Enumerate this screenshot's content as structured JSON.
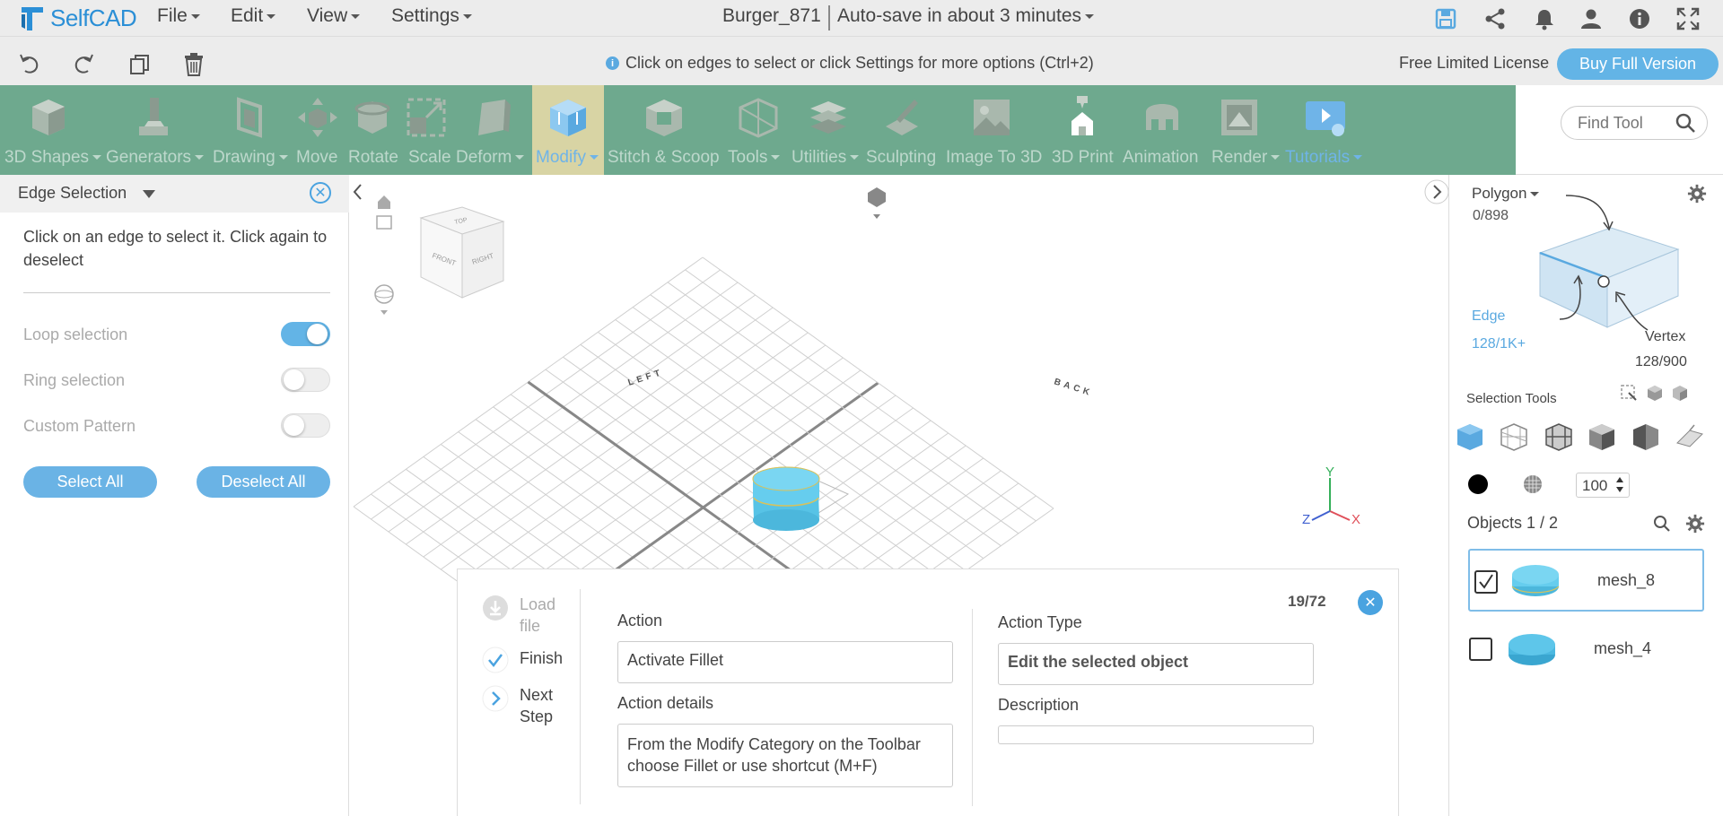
{
  "app": {
    "name": "SelfCAD"
  },
  "menu": {
    "file": "File",
    "edit": "Edit",
    "view": "View",
    "settings": "Settings"
  },
  "document": {
    "name": "Burger_871",
    "autosave": "Auto-save in about 3 minutes"
  },
  "top_icons": [
    "save-icon",
    "share-icon",
    "bell-icon",
    "user-icon",
    "info-icon",
    "fullscreen-icon"
  ],
  "secondary_bar": {
    "icons": [
      "undo-icon",
      "redo-icon",
      "copy-icon",
      "trash-icon"
    ],
    "hint": "Click on edges to select or click Settings for more options (Ctrl+2)",
    "license": "Free Limited License",
    "buy_button": "Buy Full Version"
  },
  "toolbar": {
    "tools": [
      {
        "label": "3D Shapes",
        "dropdown": true
      },
      {
        "label": "Generators",
        "dropdown": true
      },
      {
        "label": "Drawing",
        "dropdown": true
      },
      {
        "label": "Move",
        "dropdown": false
      },
      {
        "label": "Rotate",
        "dropdown": false
      },
      {
        "label": "Scale",
        "dropdown": false
      },
      {
        "label": "Deform",
        "dropdown": true
      },
      {
        "label": "Modify",
        "dropdown": true,
        "active": true
      },
      {
        "label": "Stitch & Scoop",
        "dropdown": false
      },
      {
        "label": "Tools",
        "dropdown": true
      },
      {
        "label": "Utilities",
        "dropdown": true
      },
      {
        "label": "Sculpting",
        "dropdown": false
      },
      {
        "label": "Image To 3D",
        "dropdown": false
      },
      {
        "label": "3D Print",
        "dropdown": false
      },
      {
        "label": "Animation",
        "dropdown": false
      },
      {
        "label": "Render",
        "dropdown": true
      },
      {
        "label": "Tutorials",
        "dropdown": true
      }
    ],
    "find_tool_placeholder": "Find Tool",
    "bg_color": "#6ea98e",
    "accent_color": "#63b4e6"
  },
  "left_panel": {
    "title": "Edge Selection",
    "description": "Click on an edge to select it. Click again to deselect",
    "options": [
      {
        "label": "Loop selection",
        "on": true
      },
      {
        "label": "Ring selection",
        "on": false
      },
      {
        "label": "Custom Pattern",
        "on": false
      }
    ],
    "select_all": "Select All",
    "deselect_all": "Deselect All"
  },
  "viewport": {
    "grid_labels": {
      "left": "LEFT",
      "back": "BACK"
    },
    "cube_faces": {
      "top": "TOP",
      "front": "FRONT",
      "right": "RIGHT"
    },
    "axes": {
      "x": "X",
      "y": "Y",
      "z": "Z"
    }
  },
  "wizard": {
    "step_counter": "19/72",
    "steps": {
      "load_file": "Load file",
      "finish": "Finish",
      "next_step": "Next Step"
    },
    "action_label": "Action",
    "action_value": "Activate Fillet",
    "action_details_label": "Action details",
    "action_details_value": "From the Modify Category on the Toolbar choose Fillet or use shortcut (M+F)",
    "action_type_label": "Action Type",
    "action_type_value": "Edit the selected object",
    "description_label": "Description",
    "description_value": ""
  },
  "right_panel": {
    "polygon_label": "Polygon",
    "polygon_count": "0/898",
    "edge_label": "Edge",
    "edge_count": "128/1K+",
    "vertex_label": "Vertex",
    "vertex_count": "128/900",
    "selection_tools_label": "Selection Tools",
    "opacity_value": "100",
    "objects_label": "Objects 1 / 2",
    "objects": [
      {
        "name": "mesh_8",
        "checked": true,
        "selected": true
      },
      {
        "name": "mesh_4",
        "checked": false,
        "selected": false
      }
    ]
  }
}
